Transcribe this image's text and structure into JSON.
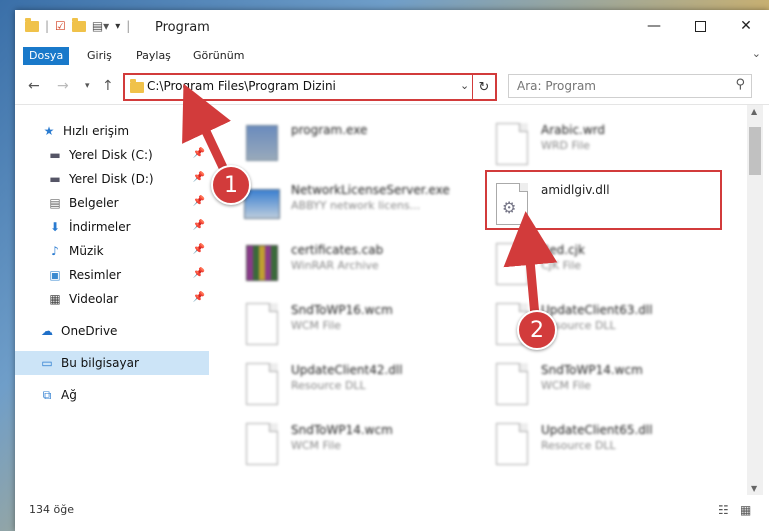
{
  "window": {
    "title": "Program"
  },
  "ribbon": {
    "tabs": [
      "Dosya",
      "Giriş",
      "Paylaş",
      "Görünüm"
    ]
  },
  "address": {
    "path": "C:\\Program Files\\Program Dizini"
  },
  "search": {
    "placeholder": "Ara: Program"
  },
  "sidebar": {
    "items": [
      {
        "label": "Hızlı erişim",
        "icon": "star-icon"
      },
      {
        "label": "Yerel Disk (C:)",
        "icon": "drive-icon"
      },
      {
        "label": "Yerel Disk (D:)",
        "icon": "drive-icon"
      },
      {
        "label": "Belgeler",
        "icon": "documents-icon"
      },
      {
        "label": "İndirmeler",
        "icon": "download-icon"
      },
      {
        "label": "Müzik",
        "icon": "music-icon"
      },
      {
        "label": "Resimler",
        "icon": "pictures-icon"
      },
      {
        "label": "Videolar",
        "icon": "videos-icon"
      },
      {
        "label": "OneDrive",
        "icon": "cloud-icon"
      },
      {
        "label": "Bu bilgisayar",
        "icon": "computer-icon"
      },
      {
        "label": "Ağ",
        "icon": "network-icon"
      }
    ]
  },
  "files": [
    {
      "name": "program.exe",
      "type": ""
    },
    {
      "name": "Arabic.wrd",
      "type": "WRD File"
    },
    {
      "name": "NetworkLicenseServer.exe",
      "type": "ABBYY network licens..."
    },
    {
      "name": "amidlgiv.dll",
      "type": ""
    },
    {
      "name": "certificates.cab",
      "type": "WinRAR Archive"
    },
    {
      "name": "Bed.cjk",
      "type": "CJK File"
    },
    {
      "name": "SndToWP16.wcm",
      "type": "WCM File"
    },
    {
      "name": "UpdateClient63.dll",
      "type": "Resource DLL"
    },
    {
      "name": "UpdateClient42.dll",
      "type": "Resource DLL"
    },
    {
      "name": "SndToWP14.wcm",
      "type": "WCM File"
    },
    {
      "name": "SndToWP14.wcm",
      "type": "WCM File"
    },
    {
      "name": "UpdateClient65.dll",
      "type": "Resource DLL"
    }
  ],
  "status": {
    "count": "134 öğe"
  },
  "annotations": {
    "step1": "1",
    "step2": "2"
  },
  "colors": {
    "accent": "#1979ca",
    "highlight": "#d23b3b",
    "selected": "#cce4f7"
  }
}
